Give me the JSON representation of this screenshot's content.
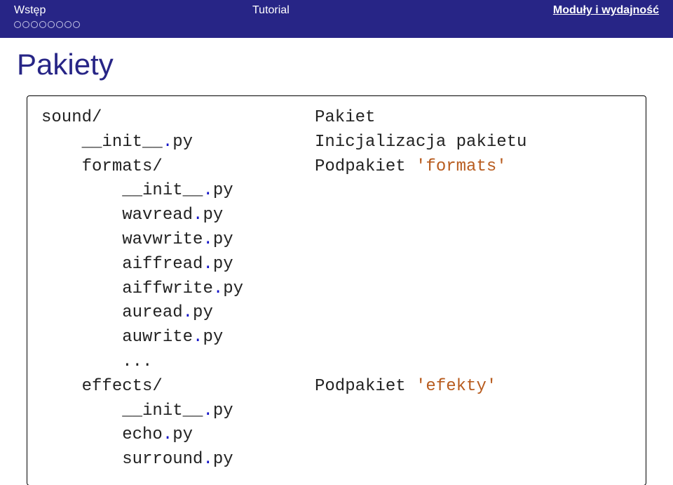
{
  "nav": {
    "left": "Wstęp",
    "center": "Tutorial",
    "right": "Moduły i wydajność"
  },
  "title": "Pakiety",
  "code": {
    "r0_l": "sound/",
    "r0_r": "Pakiet",
    "r1_seg1": "    __init__",
    "r1_seg2": ".",
    "r1_seg3": "py",
    "r1_r": "Inicjalizacja pakietu",
    "r2_l": "    formats/",
    "r2_r_pre": "Podpakiet ",
    "r2_r_str": "'formats'",
    "r3_seg1": "        __init__",
    "r3_seg2": ".",
    "r3_seg3": "py",
    "r4_seg1": "        wavread",
    "r4_seg2": ".",
    "r4_seg3": "py",
    "r5_seg1": "        wavwrite",
    "r5_seg2": ".",
    "r5_seg3": "py",
    "r6_seg1": "        aiffread",
    "r6_seg2": ".",
    "r6_seg3": "py",
    "r7_seg1": "        aiffwrite",
    "r7_seg2": ".",
    "r7_seg3": "py",
    "r8_seg1": "        auread",
    "r8_seg2": ".",
    "r8_seg3": "py",
    "r9_seg1": "        auwrite",
    "r9_seg2": ".",
    "r9_seg3": "py",
    "r10_l": "        ...",
    "r11_l": "    effects/",
    "r11_r_pre": "Podpakiet ",
    "r11_r_str": "'efekty'",
    "r12_seg1": "        __init__",
    "r12_seg2": ".",
    "r12_seg3": "py",
    "r13_seg1": "        echo",
    "r13_seg2": ".",
    "r13_seg3": "py",
    "r14_seg1": "        surround",
    "r14_seg2": ".",
    "r14_seg3": "py"
  }
}
